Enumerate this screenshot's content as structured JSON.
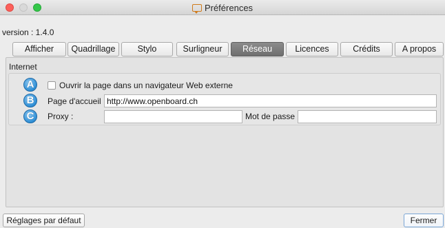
{
  "window": {
    "title": "Préférences",
    "icon": "board-icon"
  },
  "version_text": "version : 1.4.0",
  "tabs": [
    {
      "label": "Afficher",
      "active": false
    },
    {
      "label": "Quadrillage",
      "active": false
    },
    {
      "label": "Stylo",
      "active": false
    },
    {
      "label": "Surligneur",
      "active": false
    },
    {
      "label": "Réseau",
      "active": true
    },
    {
      "label": "Licences",
      "active": false
    },
    {
      "label": "Crédits",
      "active": false
    },
    {
      "label": "A propos",
      "active": false
    }
  ],
  "internet": {
    "group_title": "Internet",
    "badges": [
      "A",
      "B",
      "C"
    ],
    "open_external_label": "Ouvrir la page dans un navigateur Web externe",
    "open_external_checked": false,
    "homepage_label": "Page d'accueil :",
    "homepage_value": "http://www.openboard.ch",
    "proxy_label": "Proxy :",
    "proxy_value": "",
    "password_label": "Mot de passe :",
    "password_value": ""
  },
  "footer": {
    "defaults_button": "Réglages par défaut",
    "close_button": "Fermer"
  }
}
